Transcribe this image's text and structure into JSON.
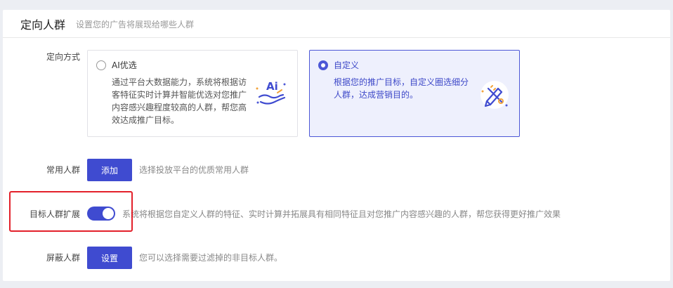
{
  "header": {
    "title": "定向人群",
    "subtitle": "设置您的广告将展现给哪些人群"
  },
  "targeting_method": {
    "label": "定向方式",
    "options": [
      {
        "title": "AI优选",
        "description_lines": [
          "通过平台大数据能力，系统将根据访",
          "客特征实时计算并智能优选对您推广",
          "内容感兴趣程度较高的人群，帮您高",
          "效达成推广目标。"
        ],
        "icon": "ai-hand-icon",
        "selected": false
      },
      {
        "title": "自定义",
        "description_lines": [
          "根据您的推广目标，自定义圈选细分",
          "人群，达成营销目的。"
        ],
        "icon": "pencil-ruler-icon",
        "selected": true
      }
    ]
  },
  "common_audience": {
    "label": "常用人群",
    "button": "添加",
    "hint": "选择投放平台的优质常用人群"
  },
  "audience_expansion": {
    "label": "目标人群扩展",
    "enabled": true,
    "hint": "系统将根据您自定义人群的特征、实时计算并拓展具有相同特征且对您推广内容感兴趣的人群，帮您获得更好推广效果"
  },
  "block_audience": {
    "label": "屏蔽人群",
    "button": "设置",
    "hint": "您可以选择需要过滤掉的非目标人群。"
  },
  "colors": {
    "accent": "#3f4bd0",
    "selected_bg": "#eef0fd",
    "highlight": "#e3202a"
  }
}
